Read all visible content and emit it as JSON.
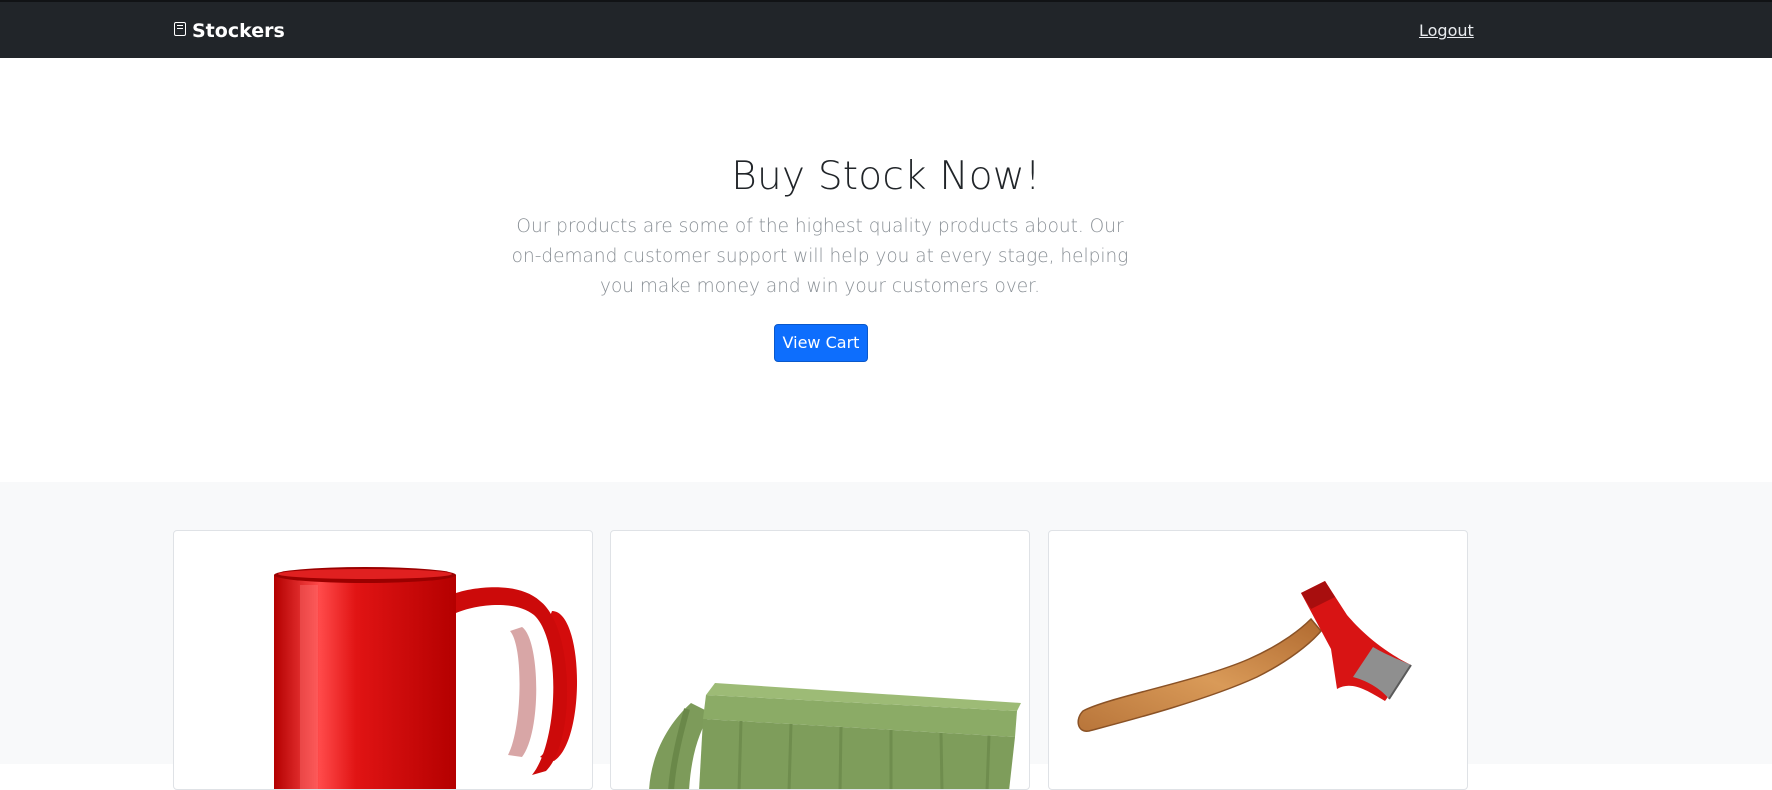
{
  "navbar": {
    "brand": "Stockers",
    "brand_icon": "newspaper-icon",
    "logout_label": "Logout"
  },
  "hero": {
    "title": "Buy Stock Now!",
    "lead": "Our products are some of the highest quality products about. Our on-demand customer support will help you at every stage, helping you make money and win your customers over.",
    "cta_label": "View Cart"
  },
  "products": [
    {
      "image": "red-mug-image"
    },
    {
      "image": "green-wheelie-bin-image"
    },
    {
      "image": "red-axe-image"
    }
  ],
  "colors": {
    "navbar_bg": "#212529",
    "primary": "#0d6efd",
    "section_bg": "#f8f9fa"
  }
}
